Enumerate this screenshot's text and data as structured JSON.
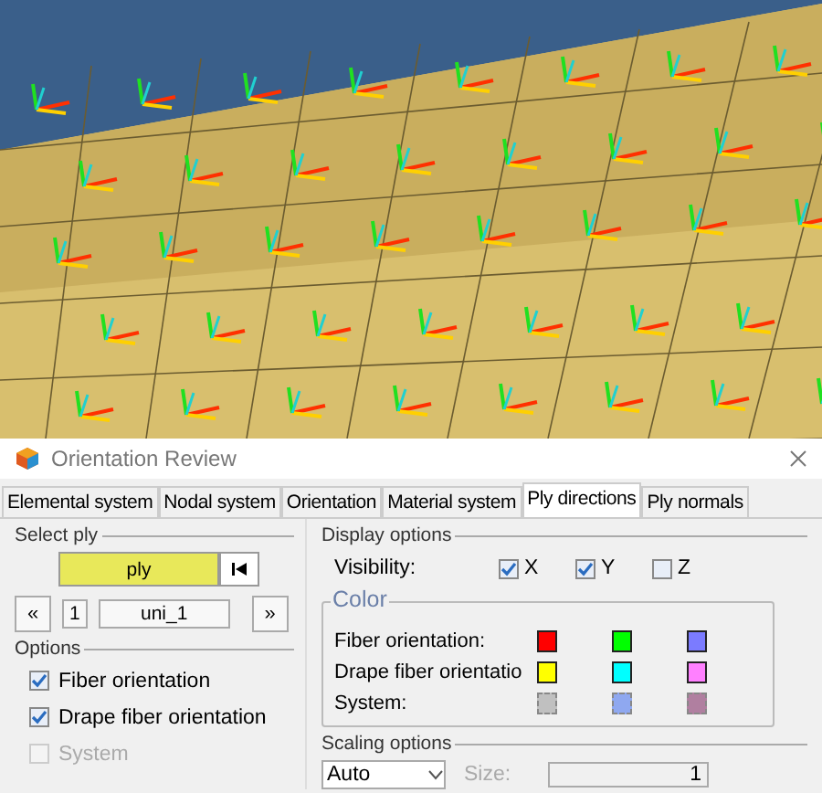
{
  "window": {
    "title": "Orientation Review"
  },
  "tabs": [
    {
      "label": "Elemental system",
      "selected": false
    },
    {
      "label": "Nodal system",
      "selected": false
    },
    {
      "label": "Orientation",
      "selected": false
    },
    {
      "label": "Material system",
      "selected": false
    },
    {
      "label": "Ply directions",
      "selected": true
    },
    {
      "label": "Ply normals",
      "selected": false
    }
  ],
  "select_ply": {
    "title": "Select ply",
    "ply_button": "ply",
    "prev": "«",
    "index": "1",
    "ply_name": "uni_1",
    "next": "»"
  },
  "options": {
    "title": "Options",
    "items": [
      {
        "label": "Fiber orientation",
        "checked": true,
        "disabled": false
      },
      {
        "label": "Drape fiber orientation",
        "checked": true,
        "disabled": false
      },
      {
        "label": "System",
        "checked": false,
        "disabled": true
      }
    ]
  },
  "display_options": {
    "title": "Display options",
    "visibility_label": "Visibility:",
    "axes": [
      {
        "label": "X",
        "checked": true
      },
      {
        "label": "Y",
        "checked": true
      },
      {
        "label": "Z",
        "checked": false
      }
    ]
  },
  "color": {
    "title": "Color",
    "rows": [
      {
        "label": "Fiber orientation:",
        "disabled": false,
        "swatches": [
          {
            "color": "#ff0000"
          },
          {
            "color": "#00ff00"
          },
          {
            "color": "#7b7bff"
          }
        ]
      },
      {
        "label": "Drape fiber orientatio",
        "disabled": false,
        "swatches": [
          {
            "color": "#ffff00"
          },
          {
            "color": "#00ffff"
          },
          {
            "color": "#ff80ff"
          }
        ]
      },
      {
        "label": "System:",
        "disabled": true,
        "swatches": [
          {
            "color": "#c0c0c0"
          },
          {
            "color": "#8fa8f0"
          },
          {
            "color": "#b07fa0"
          }
        ]
      }
    ]
  },
  "scaling": {
    "title": "Scaling options",
    "mode": "Auto",
    "size_label": "Size:",
    "size": "1",
    "size_disabled": true
  }
}
